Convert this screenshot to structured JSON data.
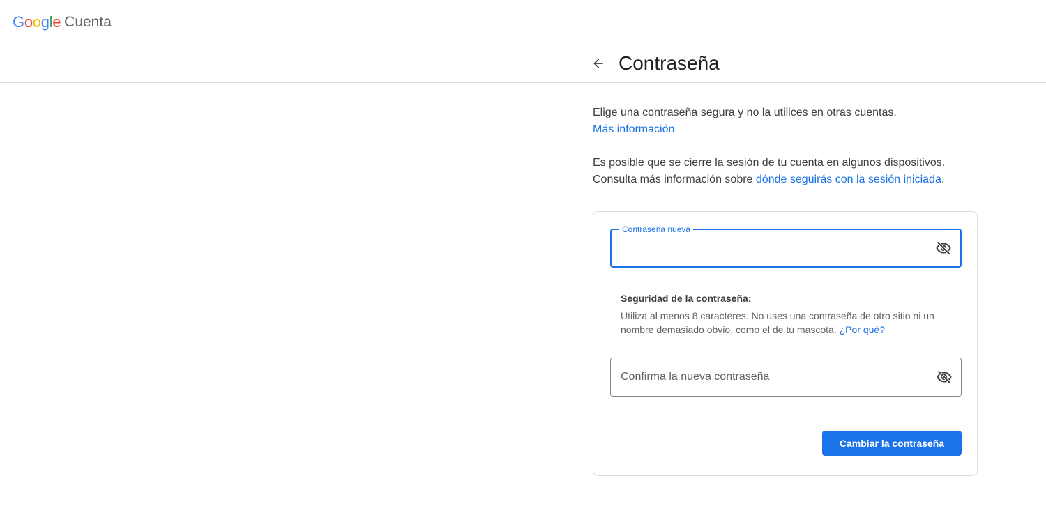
{
  "header": {
    "logo_letters": [
      "G",
      "o",
      "o",
      "g",
      "l",
      "e"
    ],
    "product": "Cuenta"
  },
  "page": {
    "title": "Contraseña",
    "intro": "Elige una contraseña segura y no la utilices en otras cuentas.",
    "learn_more": "Más información",
    "signout_note": "Es posible que se cierre la sesión de tu cuenta en algunos dispositivos. Consulta más información sobre ",
    "signout_link": "dónde seguirás con la sesión iniciada",
    "signout_end": "."
  },
  "form": {
    "new_password": {
      "label": "Contraseña nueva",
      "value": ""
    },
    "strength": {
      "title": "Seguridad de la contraseña:",
      "text": "Utiliza al menos 8 caracteres. No uses una contraseña de otro sitio ni un nombre demasiado obvio, como el de tu mascota. ",
      "why_link": "¿Por qué?"
    },
    "confirm_password": {
      "placeholder": "Confirma la nueva contraseña",
      "value": ""
    },
    "submit_label": "Cambiar la contraseña"
  },
  "icons": {
    "back": "arrow-back-icon",
    "toggle_visibility": "eye-off-icon"
  },
  "colors": {
    "accent": "#1a73e8",
    "text": "#202124",
    "secondary_text": "#5f6368",
    "border": "#dadce0"
  }
}
